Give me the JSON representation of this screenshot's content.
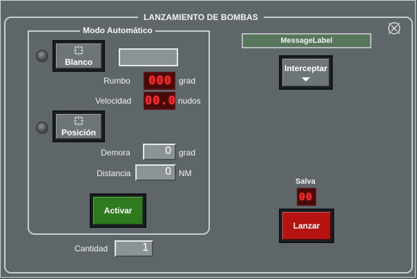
{
  "window": {
    "title": "LANZAMIENTO DE BOMBAS"
  },
  "message_label": "MessageLabel",
  "auto_mode": {
    "title": "Modo Automático",
    "blanco_button": "Blanco",
    "blanco_field_value": "",
    "rumbo_label": "Rumbo",
    "rumbo_value": "000",
    "rumbo_unit": "grad",
    "velocidad_label": "Velocidad",
    "velocidad_value": "00.0",
    "velocidad_unit": "nudos",
    "posicion_button": "Posición",
    "demora_label": "Demora",
    "demora_value": "0",
    "demora_unit": "grad",
    "distancia_label": "Distancia",
    "distancia_value": "0",
    "distancia_unit": "NM",
    "activar_button": "Activar"
  },
  "cantidad": {
    "label": "Cantidad",
    "value": "1"
  },
  "interceptar_button": "Interceptar",
  "salva": {
    "label": "Salva",
    "value": "00"
  },
  "lanzar_button": "Lanzar",
  "icons": {
    "close": "close-icon",
    "led": "indicator-led",
    "target": "target-reticle-icon",
    "dropdown": "chevron-down-icon"
  },
  "colors": {
    "panel": "#5f666a",
    "activar": "#2f7a1f",
    "lanzar": "#b51212",
    "segment_display": "#ff2d2d",
    "message_label_bg": "#56775b"
  }
}
